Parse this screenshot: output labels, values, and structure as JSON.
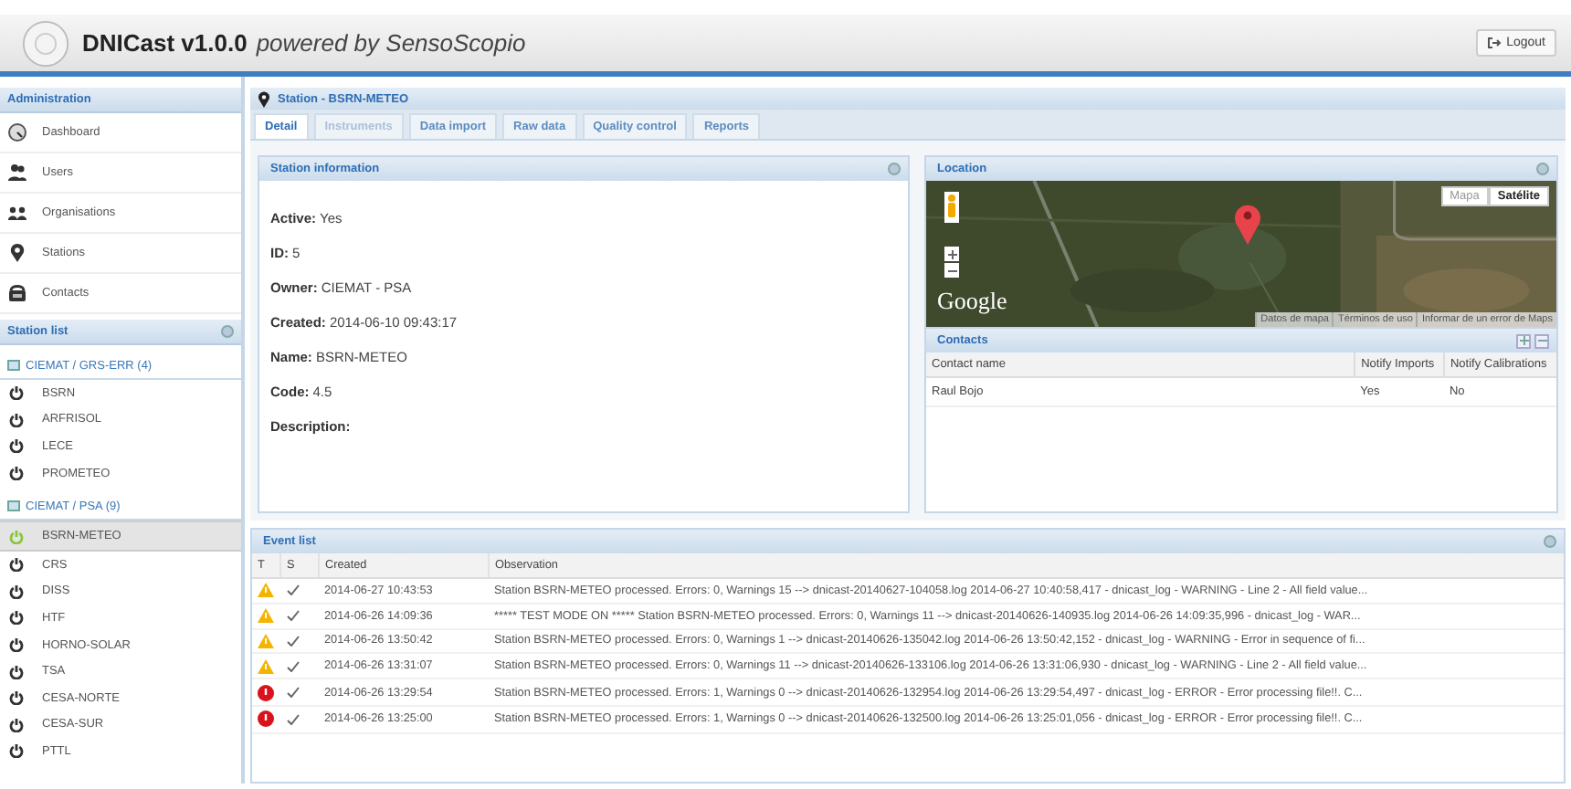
{
  "header": {
    "title": "DNICast v1.0.0",
    "subtitle": "powered by SensoScopio",
    "logout": "Logout"
  },
  "sidebar": {
    "admin_title": "Administration",
    "admin_items": [
      {
        "label": "Dashboard",
        "kind": "dashboard"
      },
      {
        "label": "Users",
        "kind": "users"
      },
      {
        "label": "Organisations",
        "kind": "organisations"
      },
      {
        "label": "Stations",
        "kind": "stations"
      },
      {
        "label": "Contacts",
        "kind": "contacts"
      }
    ],
    "station_list_title": "Station list",
    "groups": [
      {
        "label": "CIEMAT / GRS-ERR (4)",
        "stations": [
          {
            "label": "BSRN",
            "selected": false
          },
          {
            "label": "ARFRISOL",
            "selected": false
          },
          {
            "label": "LECE",
            "selected": false
          },
          {
            "label": "PROMETEO",
            "selected": false
          }
        ]
      },
      {
        "label": "CIEMAT / PSA (9)",
        "stations": [
          {
            "label": "BSRN-METEO",
            "selected": true
          },
          {
            "label": "CRS",
            "selected": false
          },
          {
            "label": "DISS",
            "selected": false
          },
          {
            "label": "HTF",
            "selected": false
          },
          {
            "label": "HORNO-SOLAR",
            "selected": false
          },
          {
            "label": "TSA",
            "selected": false
          },
          {
            "label": "CESA-NORTE",
            "selected": false
          },
          {
            "label": "CESA-SUR",
            "selected": false
          },
          {
            "label": "PTTL",
            "selected": false
          }
        ]
      }
    ]
  },
  "station": {
    "title": "Station - BSRN-METEO",
    "tabs": [
      {
        "label": "Detail",
        "selected": true,
        "disabled": false
      },
      {
        "label": "Instruments",
        "selected": false,
        "disabled": true
      },
      {
        "label": "Data import",
        "selected": false,
        "disabled": false
      },
      {
        "label": "Raw data",
        "selected": false,
        "disabled": false
      },
      {
        "label": "Quality control",
        "selected": false,
        "disabled": false
      },
      {
        "label": "Reports",
        "selected": false,
        "disabled": false
      }
    ]
  },
  "station_information": {
    "title": "Station information",
    "fields": [
      {
        "label": "Active:",
        "value": "Yes"
      },
      {
        "label": "ID:",
        "value": "5"
      },
      {
        "label": "Owner:",
        "value": "CIEMAT - PSA"
      },
      {
        "label": "Created:",
        "value": "2014-06-10 09:43:17"
      },
      {
        "label": "Name:",
        "value": "BSRN-METEO"
      },
      {
        "label": "Code:",
        "value": "4.5"
      },
      {
        "label": "Description:"
      }
    ]
  },
  "location": {
    "title": "Location",
    "map": {
      "kind": "picture",
      "map_types": [
        {
          "label": "Mapa",
          "selected": false
        },
        {
          "label": "Satélite",
          "selected": true
        }
      ],
      "logo": "Google",
      "attribution": [
        "Datos de mapa",
        "Términos de uso",
        "Informar de un error de Maps"
      ]
    }
  },
  "contacts": {
    "title": "Contacts",
    "columns": [
      "Contact name",
      "Notify Imports",
      "Notify Calibrations"
    ],
    "rows": [
      [
        "Raul Bojo",
        "Yes",
        "No"
      ]
    ]
  },
  "event_list": {
    "title": "Event list",
    "columns": [
      "T",
      "S",
      "Created",
      "Observation"
    ],
    "rows": [
      {
        "kind": "warning",
        "created": "2014-06-27 10:43:53",
        "observation": "Station BSRN-METEO processed. Errors: 0, Warnings 15 --> dnicast-20140627-104058.log 2014-06-27 10:40:58,417 - dnicast_log - WARNING - Line 2 - All field value..."
      },
      {
        "kind": "warning",
        "created": "2014-06-26 14:09:36",
        "observation": "***** TEST MODE ON ***** Station BSRN-METEO processed. Errors: 0, Warnings 11 --> dnicast-20140626-140935.log 2014-06-26 14:09:35,996 - dnicast_log - WAR..."
      },
      {
        "kind": "warning",
        "created": "2014-06-26 13:50:42",
        "observation": "Station BSRN-METEO processed. Errors: 0, Warnings 1 --> dnicast-20140626-135042.log 2014-06-26 13:50:42,152 - dnicast_log - WARNING - Error in sequence of fi..."
      },
      {
        "kind": "warning",
        "created": "2014-06-26 13:31:07",
        "observation": "Station BSRN-METEO processed. Errors: 0, Warnings 11 --> dnicast-20140626-133106.log 2014-06-26 13:31:06,930 - dnicast_log - WARNING - Line 2 - All field value..."
      },
      {
        "kind": "error",
        "created": "2014-06-26 13:29:54",
        "observation": "Station BSRN-METEO processed. Errors: 1, Warnings 0 --> dnicast-20140626-132954.log 2014-06-26 13:29:54,497 - dnicast_log - ERROR - Error processing file!!. C..."
      },
      {
        "kind": "error",
        "created": "2014-06-26 13:25:00",
        "observation": "Station BSRN-METEO processed. Errors: 1, Warnings 0 --> dnicast-20140626-132500.log 2014-06-26 13:25:01,056 - dnicast_log - ERROR - Error processing file!!. C..."
      }
    ]
  }
}
